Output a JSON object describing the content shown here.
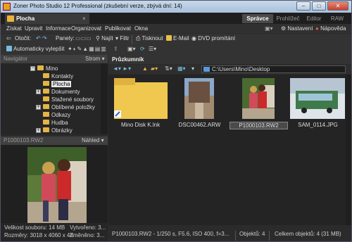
{
  "window": {
    "title": "Zoner Photo Studio 12 Professional (zkušební verze, zbývá dní: 14)",
    "min": "–",
    "max": "□",
    "close": "✕"
  },
  "tabs": {
    "main": "Plocha",
    "close": "×",
    "modes": [
      "Správce",
      "Prohlížeč",
      "Editor",
      "RAW"
    ]
  },
  "menu": {
    "items": [
      "Získat",
      "Upravit",
      "Informace",
      "Organizovat",
      "Publikovat",
      "Okna"
    ],
    "right": [
      "Nastavení",
      "Nápověda"
    ]
  },
  "toolbar1": {
    "rotate": "Otočit:",
    "panels": "Panely:",
    "find": "Najít",
    "filter": "Filtr",
    "print": "Tisknout",
    "email": "E-Mail",
    "dvd": "DVD promítání"
  },
  "toolbar2": {
    "autofix": "Automaticky vylepšit"
  },
  "navigator": {
    "title": "Navigátor",
    "mode": "Strom",
    "tree": [
      {
        "label": "Mino",
        "indent": 0,
        "expander": "−"
      },
      {
        "label": "Kontakty",
        "indent": 1,
        "expander": ""
      },
      {
        "label": "Plocha",
        "indent": 1,
        "expander": "",
        "selected": true
      },
      {
        "label": "Dokumenty",
        "indent": 1,
        "expander": "+"
      },
      {
        "label": "Stažené soubory",
        "indent": 1,
        "expander": ""
      },
      {
        "label": "Oblíbené položky",
        "indent": 1,
        "expander": "+"
      },
      {
        "label": "Odkazy",
        "indent": 1,
        "expander": ""
      },
      {
        "label": "Hudba",
        "indent": 1,
        "expander": ""
      },
      {
        "label": "Obrázky",
        "indent": 1,
        "expander": "+"
      }
    ]
  },
  "preview": {
    "title": "P1000103.RW2",
    "mode": "Náhled",
    "size": "Velikost souboru: 14 MB",
    "created": "Vytvořeno: 3...",
    "dimensions": "Rozměry: 3018 x 4060 x 48",
    "modified": "Změněno: 3..."
  },
  "browser": {
    "title": "Průzkumník",
    "path": "C:\\Users\\Mino\\Desktop",
    "files": [
      {
        "name": "Mino Disk K.lnk"
      },
      {
        "name": "DSC00462.ARW"
      },
      {
        "name": "P1000103.RW2",
        "selected": true
      },
      {
        "name": "SAM_0114.JPG"
      }
    ]
  },
  "status": {
    "info": "P1000103.RW2 - 1/250 s, F5.6, ISO 400, f=3...",
    "objects": "Objektů: 4",
    "total": "Celkem objektů: 4 (31 MB)"
  },
  "colors": {
    "accent": "#e4b545",
    "bg": "#2b2b2b"
  }
}
